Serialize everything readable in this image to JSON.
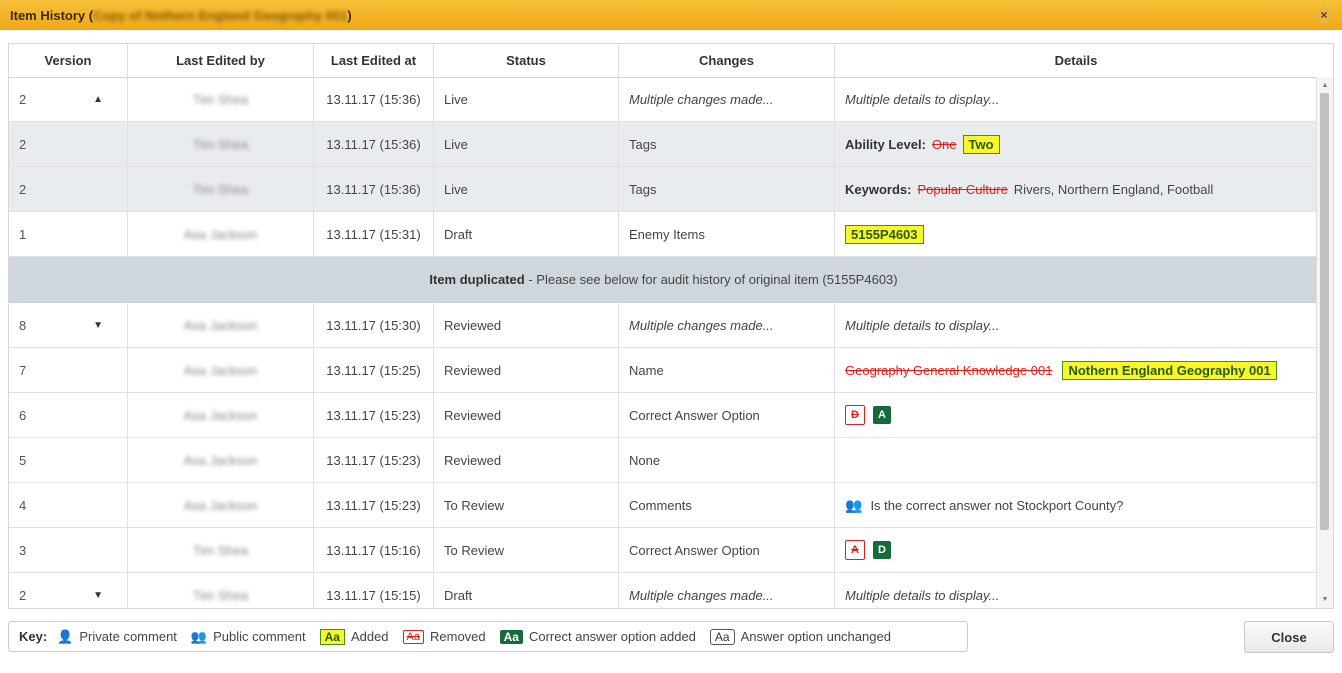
{
  "dialog": {
    "title_prefix": "Item History (",
    "title_item_blurred": "Copy of Nothern England Geography 001",
    "title_suffix": ")",
    "close_icon": "close-icon"
  },
  "table": {
    "headers": [
      "Version",
      "Last Edited by",
      "Last Edited at",
      "Status",
      "Changes",
      "Details"
    ],
    "rows": [
      {
        "version": "2",
        "by": "Tim Shea",
        "at": "13.11.17 (15:36)",
        "status": "Live",
        "changes": "Multiple changes made...",
        "details_text": "Multiple details to display...",
        "arrow": "up"
      },
      {
        "version": "2",
        "by": "Tim Shea",
        "at": "13.11.17 (15:36)",
        "status": "Live",
        "changes": "Tags",
        "detail_label": "Ability Level:",
        "detail_removed": "One",
        "detail_added": "Two"
      },
      {
        "version": "2",
        "by": "Tim Shea",
        "at": "13.11.17 (15:36)",
        "status": "Live",
        "changes": "Tags",
        "detail_label": "Keywords:",
        "detail_removed": "Popular Culture",
        "detail_normal": "Rivers, Northern England, Football"
      },
      {
        "version": "1",
        "by": "Asa Jackson",
        "at": "13.11.17 (15:31)",
        "status": "Draft",
        "changes": "Enemy Items",
        "detail_added": "5155P4603"
      },
      {
        "version": "8",
        "by": "Asa Jackson",
        "at": "13.11.17 (15:30)",
        "status": "Reviewed",
        "changes": "Multiple changes made...",
        "details_text": "Multiple details to display...",
        "arrow": "down"
      },
      {
        "version": "7",
        "by": "Asa Jackson",
        "at": "13.11.17 (15:25)",
        "status": "Reviewed",
        "changes": "Name",
        "detail_removed": "Geography General Knowledge 001",
        "detail_added": "Nothern England Geography 001"
      },
      {
        "version": "6",
        "by": "Asa Jackson",
        "at": "13.11.17 (15:23)",
        "status": "Reviewed",
        "changes": "Correct Answer Option",
        "option_removed": "D",
        "option_correct": "A"
      },
      {
        "version": "5",
        "by": "Asa Jackson",
        "at": "13.11.17 (15:23)",
        "status": "Reviewed",
        "changes": "None"
      },
      {
        "version": "4",
        "by": "Asa Jackson",
        "at": "13.11.17 (15:23)",
        "status": "To Review",
        "changes": "Comments",
        "comment_icon": "public-comment-icon",
        "comment": "Is the correct answer not Stockport County?"
      },
      {
        "version": "3",
        "by": "Tim Shea",
        "at": "13.11.17 (15:16)",
        "status": "To Review",
        "changes": "Correct Answer Option",
        "option_removed": "A",
        "option_correct": "D"
      },
      {
        "version": "2",
        "by": "Tim Shea",
        "at": "13.11.17 (15:15)",
        "status": "Draft",
        "changes": "Multiple changes made...",
        "details_text": "Multiple details to display...",
        "arrow": "down"
      }
    ],
    "duplicated_bold": "Item duplicated",
    "duplicated_text": " - Please see below for audit history of original item (5155P4603)"
  },
  "key": {
    "title": "Key:",
    "private_comment": "Private comment",
    "public_comment": "Public comment",
    "added_sample": "Aa",
    "added": "Added",
    "removed_sample": "Aa",
    "removed": "Removed",
    "correct_sample": "Aa",
    "correct_added": "Correct answer option added",
    "unchanged_sample": "Aa",
    "unchanged": "Answer option unchanged"
  },
  "buttons": {
    "close": "Close"
  },
  "colors": {
    "titlebar": "#f0a818",
    "added_bg": "#f7f72a",
    "removed": "#e0201a",
    "correct_bg": "#156b3a",
    "grey_row": "#e9ecef",
    "dup_row": "#cfd6dc"
  }
}
